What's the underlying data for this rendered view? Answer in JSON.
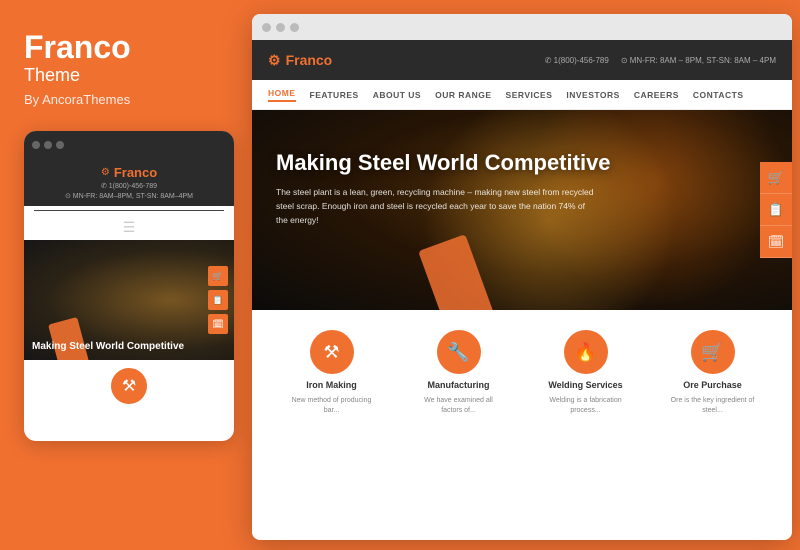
{
  "left": {
    "title": "Franco",
    "subtitle": "Theme",
    "author": "By AncoraThemes",
    "dots": [
      "dot1",
      "dot2",
      "dot3"
    ]
  },
  "mobile": {
    "logo": "Franco",
    "phone": "✆ 1(800)-456-789",
    "hours": "⊙ MN-FR: 8AM–8PM, ST-SN: 8AM–4PM",
    "hero_text": "Making Steel World Competitive",
    "cart_icons": [
      "🛒",
      "📋",
      "🗓"
    ],
    "dots": [
      "dot1",
      "dot2",
      "dot3"
    ]
  },
  "desktop": {
    "dots": [
      "dot1",
      "dot2",
      "dot3"
    ],
    "header": {
      "logo": "Franco",
      "phone": "✆ 1(800)-456-789",
      "hours": "⊙ MN-FR: 8AM – 8PM, ST-SN: 8AM – 4PM"
    },
    "nav": {
      "items": [
        {
          "label": "HOME",
          "active": true
        },
        {
          "label": "FEATURES",
          "active": false
        },
        {
          "label": "ABOUT US",
          "active": false
        },
        {
          "label": "OUR RANGE",
          "active": false
        },
        {
          "label": "SERVICES",
          "active": false
        },
        {
          "label": "INVESTORS",
          "active": false
        },
        {
          "label": "CAREERS",
          "active": false
        },
        {
          "label": "CONTACTS",
          "active": false
        }
      ]
    },
    "hero": {
      "title": "Making Steel World Competitive",
      "subtitle": "The steel plant is a lean, green, recycling machine – making new steel from recycled steel scrap. Enough iron and steel is recycled each year to save the nation 74% of the energy!",
      "side_icons": [
        "🛒",
        "📋",
        "🗓"
      ]
    },
    "features": [
      {
        "icon": "⚒",
        "title": "Iron Making",
        "desc": "New method of producing bar..."
      },
      {
        "icon": "🔧",
        "title": "Manufacturing",
        "desc": "We have examined all factors of..."
      },
      {
        "icon": "🔥",
        "title": "Welding Services",
        "desc": "Welding is a fabrication process..."
      },
      {
        "icon": "🛒",
        "title": "Ore Purchase",
        "desc": "Ore is the key ingredient of steel..."
      }
    ]
  },
  "colors": {
    "orange": "#f07030",
    "dark": "#2b2b2b",
    "light_gray": "#f5f5f5"
  }
}
